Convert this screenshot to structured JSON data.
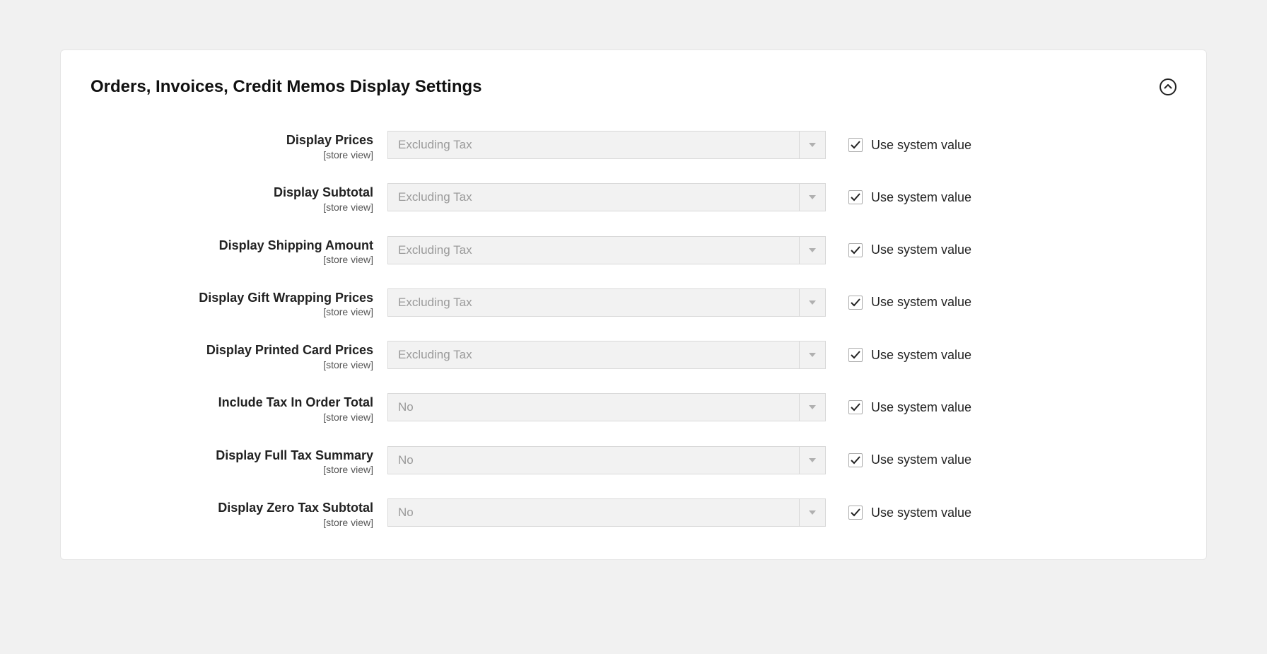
{
  "section": {
    "title": "Orders, Invoices, Credit Memos Display Settings"
  },
  "common": {
    "scope": "[store view]",
    "use_system_label": "Use system value"
  },
  "fields": [
    {
      "label": "Display Prices",
      "value": "Excluding Tax",
      "use_system": true
    },
    {
      "label": "Display Subtotal",
      "value": "Excluding Tax",
      "use_system": true
    },
    {
      "label": "Display Shipping Amount",
      "value": "Excluding Tax",
      "use_system": true
    },
    {
      "label": "Display Gift Wrapping Prices",
      "value": "Excluding Tax",
      "use_system": true
    },
    {
      "label": "Display Printed Card Prices",
      "value": "Excluding Tax",
      "use_system": true
    },
    {
      "label": "Include Tax In Order Total",
      "value": "No",
      "use_system": true
    },
    {
      "label": "Display Full Tax Summary",
      "value": "No",
      "use_system": true
    },
    {
      "label": "Display Zero Tax Subtotal",
      "value": "No",
      "use_system": true
    }
  ]
}
